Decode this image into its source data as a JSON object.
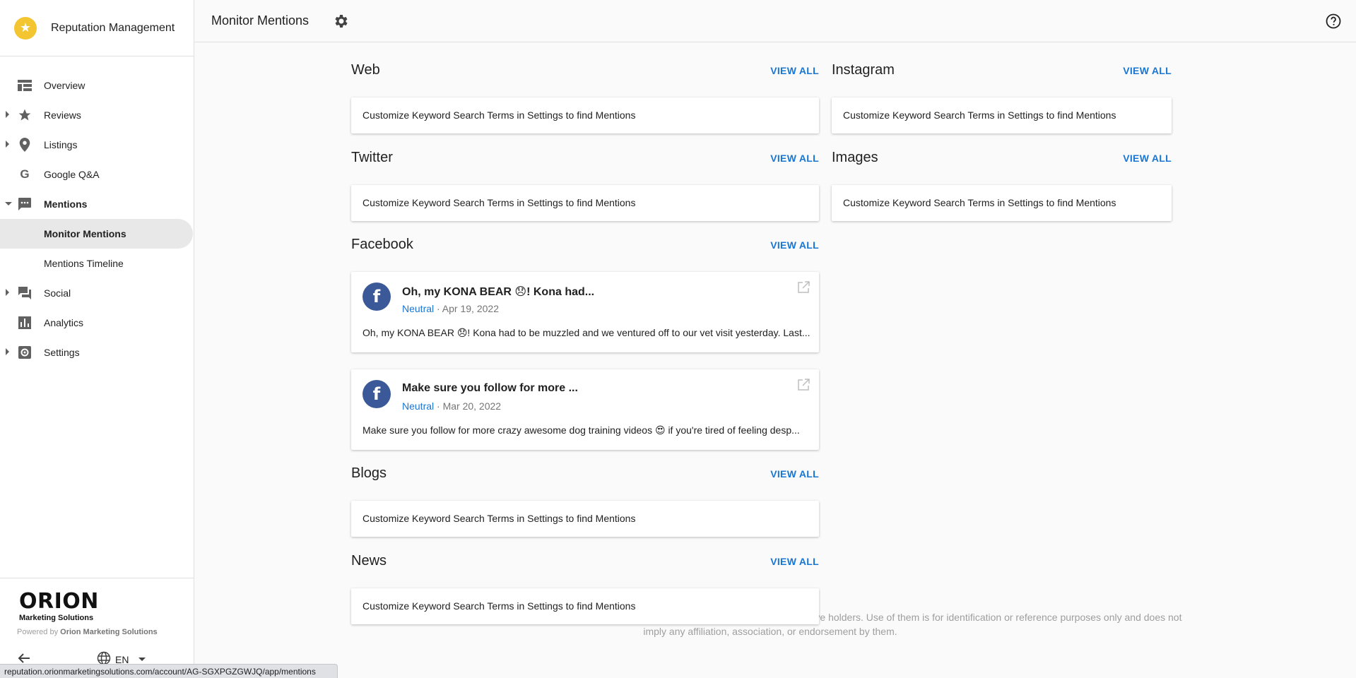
{
  "sidebar": {
    "brand_title": "Reputation Management",
    "nav": [
      {
        "label": "Overview"
      },
      {
        "label": "Reviews"
      },
      {
        "label": "Listings"
      },
      {
        "label": "Google Q&A"
      },
      {
        "label": "Mentions"
      }
    ],
    "mentions_sub": [
      {
        "label": "Monitor Mentions"
      },
      {
        "label": "Mentions Timeline"
      }
    ],
    "nav_after": [
      {
        "label": "Social"
      },
      {
        "label": "Analytics"
      },
      {
        "label": "Settings"
      }
    ],
    "footer": {
      "logo_main": "ORION",
      "logo_sub": "Marketing Solutions",
      "powered_prefix": "Powered by ",
      "powered_by": "Orion Marketing Solutions",
      "language": "EN"
    }
  },
  "header": {
    "title": "Monitor Mentions"
  },
  "common": {
    "view_all": "VIEW ALL",
    "empty_text": "Customize Keyword Search Terms in Settings to find Mentions"
  },
  "sections": {
    "web": {
      "title": "Web"
    },
    "instagram": {
      "title": "Instagram"
    },
    "twitter": {
      "title": "Twitter"
    },
    "images": {
      "title": "Images"
    },
    "facebook": {
      "title": "Facebook",
      "posts": [
        {
          "title": "Oh, my KONA BEAR 😞! Kona had...",
          "sentiment": "Neutral",
          "date": " · Apr 19, 2022",
          "text": "Oh, my KONA BEAR 😞! Kona had to be muzzled and we ventured off to our vet visit yesterday. Last..."
        },
        {
          "title": "Make sure you follow for more ...",
          "sentiment": "Neutral",
          "date": " · Mar 20, 2022",
          "text": "Make sure you follow for more crazy awesome dog training videos 😍 if you're tired of feeling desp..."
        }
      ]
    },
    "blogs": {
      "title": "Blogs"
    },
    "news": {
      "title": "News"
    }
  },
  "disclaimer": "All product and company names, logos, brands are trademarks or registered trademarks of their respective holders. Use of them is for identification or reference purposes only and does not imply any affiliation, association, or endorsement by them.",
  "status_url": "reputation.orionmarketingsolutions.com/account/AG-SGXPGZGWJQ/app/mentions",
  "colors": {
    "accent": "#1976d2",
    "brand_star": "#f2c531",
    "facebook": "#3b5998"
  }
}
